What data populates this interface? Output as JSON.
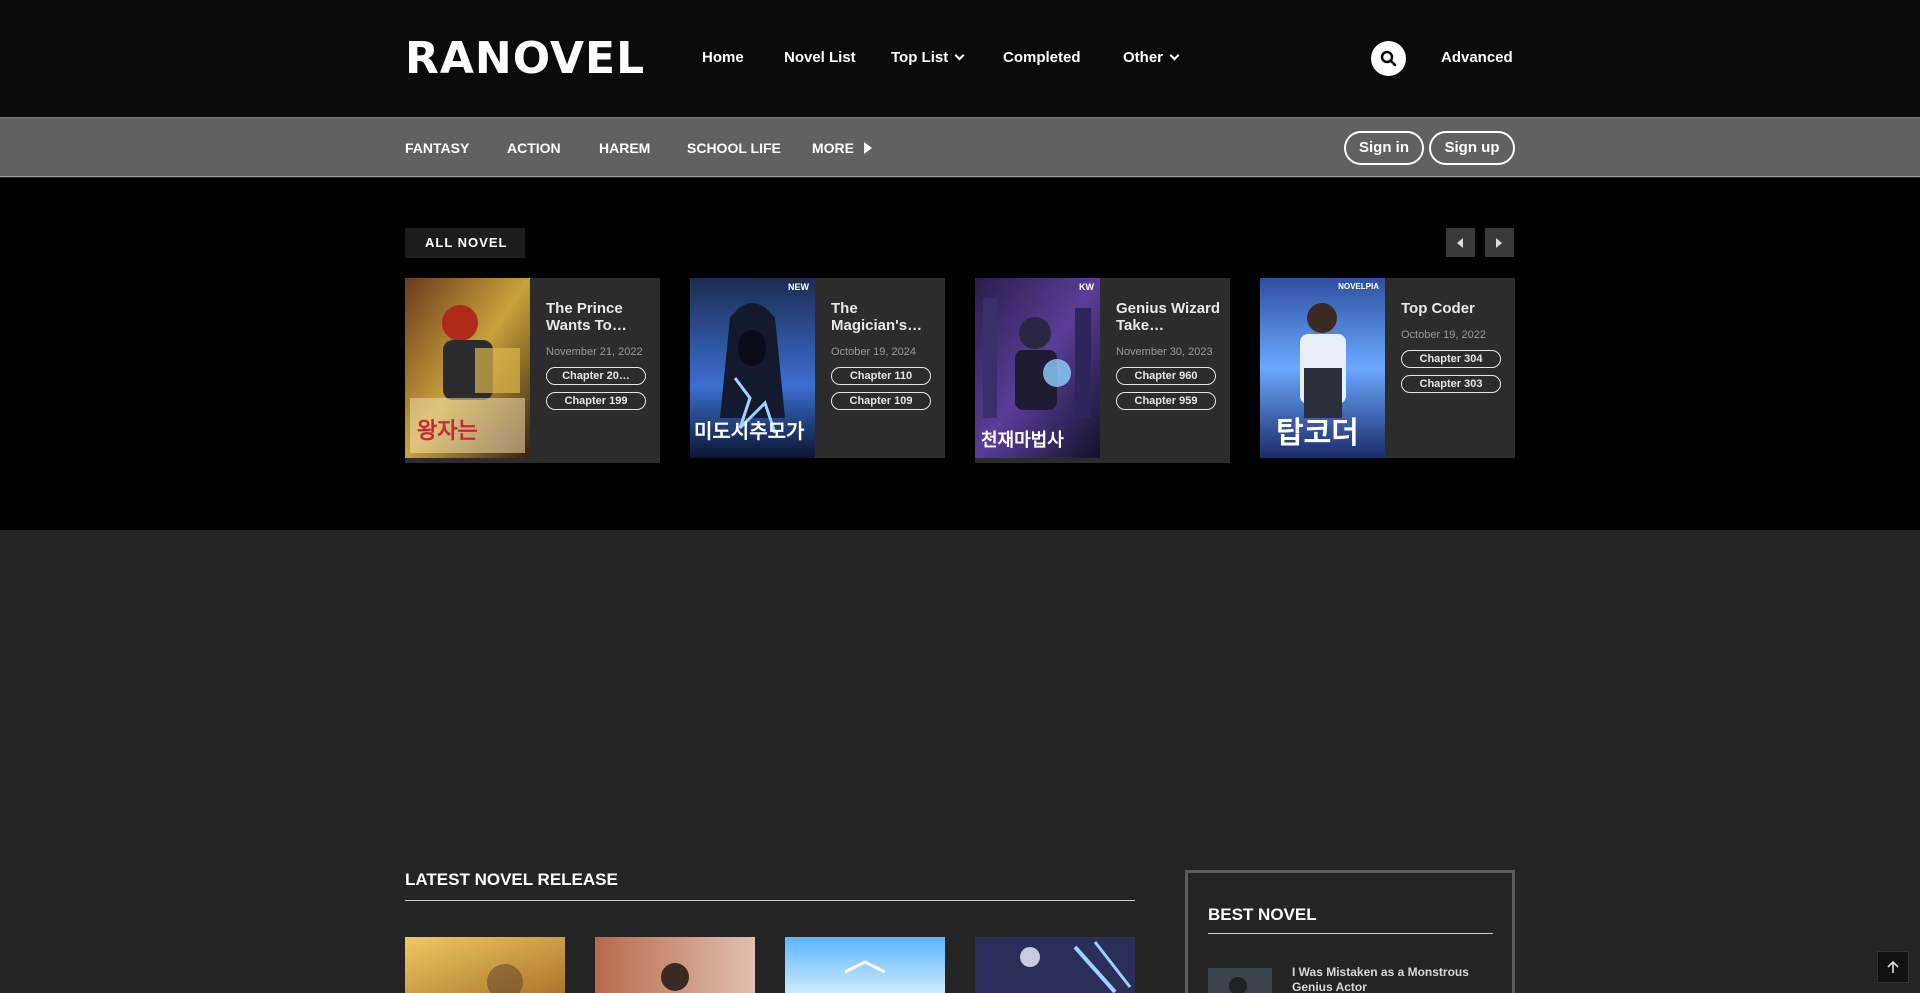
{
  "header": {
    "logo": "RANOVEL",
    "nav": [
      {
        "label": "Home"
      },
      {
        "label": "Novel List"
      },
      {
        "label": "Top List"
      },
      {
        "label": "Completed"
      },
      {
        "label": "Other"
      }
    ],
    "advanced_label": "Advanced",
    "search_icon": "search-icon"
  },
  "categories": {
    "items": [
      {
        "label": "FANTASY"
      },
      {
        "label": "ACTION"
      },
      {
        "label": "HAREM"
      },
      {
        "label": "SCHOOL LIFE"
      },
      {
        "label": "MORE"
      }
    ],
    "sign_in": "Sign in",
    "sign_up": "Sign up"
  },
  "slider": {
    "heading": "ALL NOVEL",
    "cards": [
      {
        "title": "The Prince Wants To…",
        "date": "November 21, 2022",
        "chapters": [
          "Chapter 20…",
          "Chapter 199"
        ]
      },
      {
        "title": "The Magician's…",
        "date": "October 19, 2024",
        "chapters": [
          "Chapter 110",
          "Chapter 109"
        ]
      },
      {
        "title": "Genius Wizard Take…",
        "date": "November 30, 2023",
        "chapters": [
          "Chapter 960",
          "Chapter 959"
        ]
      },
      {
        "title": "Top Coder",
        "date": "October 19, 2022",
        "chapters": [
          "Chapter 304",
          "Chapter 303"
        ]
      }
    ],
    "cover_texts": [
      "NEW",
      "KW",
      "NOVELPIA"
    ]
  },
  "latest": {
    "heading": "LATEST NOVEL RELEASE"
  },
  "best": {
    "heading": "BEST NOVEL",
    "first_item": "I Was Mistaken as a Monstrous Genius Actor"
  },
  "colors": {
    "header_bg": "#0b0b0b",
    "category_bar": "#616161",
    "page_bg": "#242424",
    "card_bg": "#2c2c2c"
  }
}
